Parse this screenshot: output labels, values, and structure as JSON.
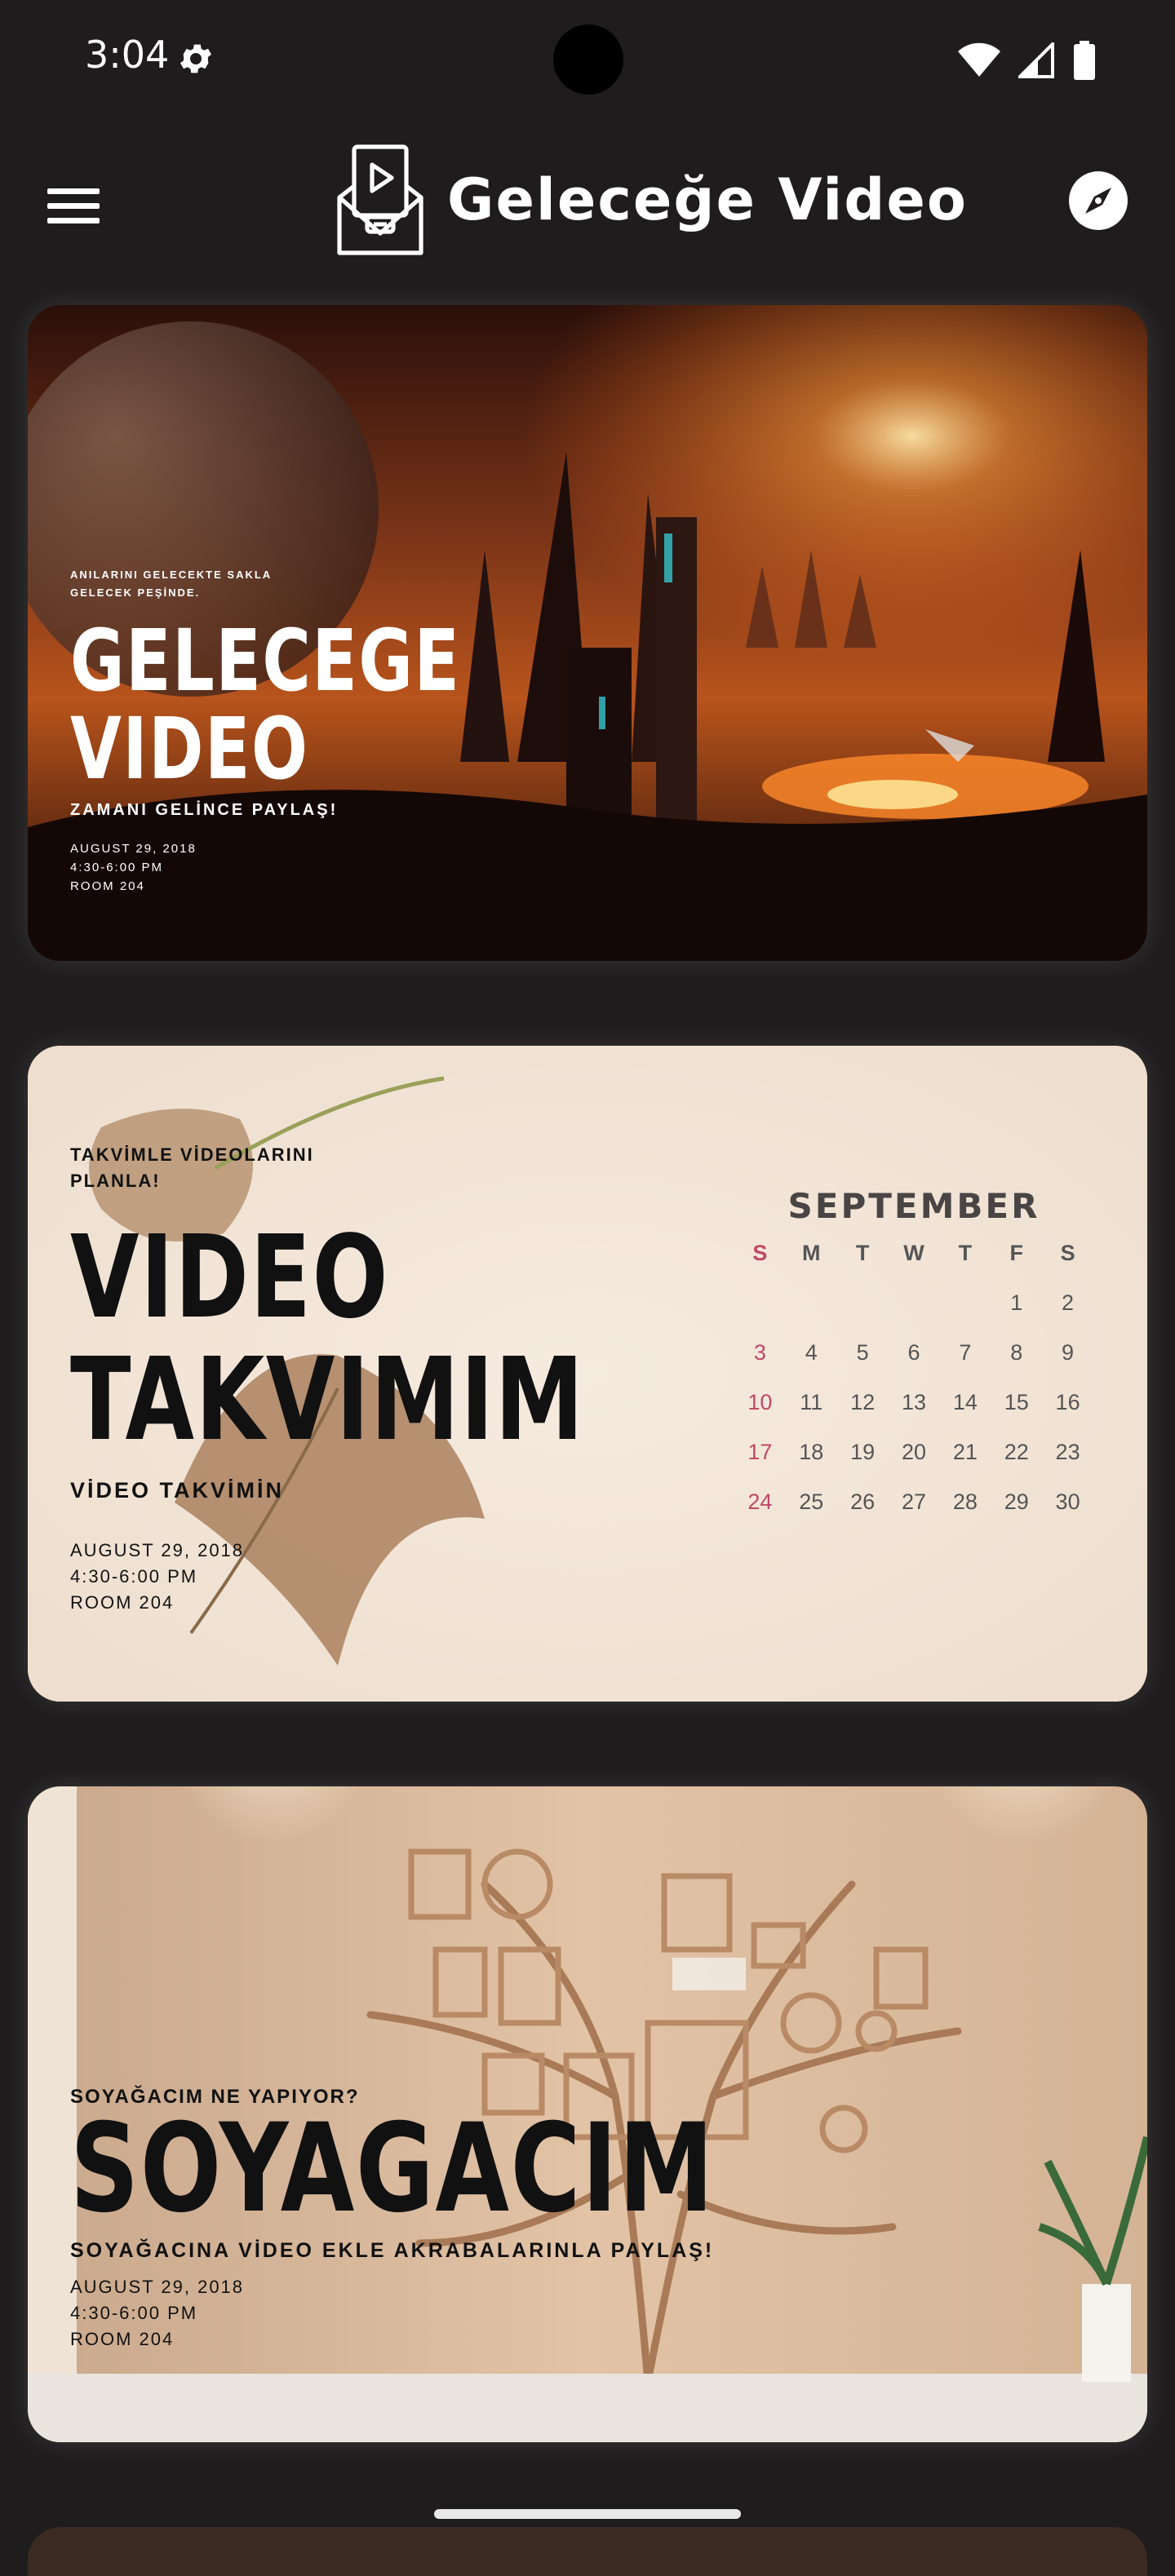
{
  "status_bar": {
    "time": "3:04",
    "icons": [
      "gear-icon",
      "wifi-icon",
      "cell-signal-icon",
      "battery-icon"
    ]
  },
  "app_bar": {
    "title": "Geleceğe Video",
    "icons": [
      "menu-icon",
      "video-envelope-logo",
      "compass-icon"
    ]
  },
  "cards": [
    {
      "eyebrow": "ANILARINI GELECEKTE SAKLA GELECEK PEŞİNDE.",
      "headline": "GELECEGE VIDEO",
      "subtitle": "ZAMANI GELİNCE PAYLAŞ!",
      "date": "AUGUST 29, 2018",
      "time": "4:30-6:00 PM",
      "room": "ROOM 204"
    },
    {
      "eyebrow": "TAKVİMLE VİDEOLARINI PLANLA!",
      "headline": "VIDEO TAKVIMIM",
      "subtitle": "VİDEO TAKVİMİN",
      "date": "AUGUST 29, 2018",
      "time": "4:30-6:00 PM",
      "room": "ROOM 204",
      "calendar": {
        "month": "SEPTEMBER",
        "days_of_week": [
          "S",
          "M",
          "T",
          "W",
          "T",
          "F",
          "S"
        ],
        "weeks": [
          [
            "",
            "",
            "",
            "",
            "",
            "1",
            "2"
          ],
          [
            "3",
            "4",
            "5",
            "6",
            "7",
            "8",
            "9"
          ],
          [
            "10",
            "11",
            "12",
            "13",
            "14",
            "15",
            "16"
          ],
          [
            "17",
            "18",
            "19",
            "20",
            "21",
            "22",
            "23"
          ],
          [
            "24",
            "25",
            "26",
            "27",
            "28",
            "29",
            "30"
          ]
        ]
      }
    },
    {
      "eyebrow": "SOYAĞACIM NE YAPIYOR?",
      "headline": "SOYAGACIM",
      "subtitle": "SOYAĞACINA VİDEO EKLE AKRABALARINLA PAYLAŞ!",
      "date": "AUGUST 29, 2018",
      "time": "4:30-6:00 PM",
      "room": "ROOM 204"
    }
  ],
  "colors": {
    "background": "#1e1c1c",
    "card2_background": "#f1e4d6",
    "sunday_accent": "#c04868"
  }
}
